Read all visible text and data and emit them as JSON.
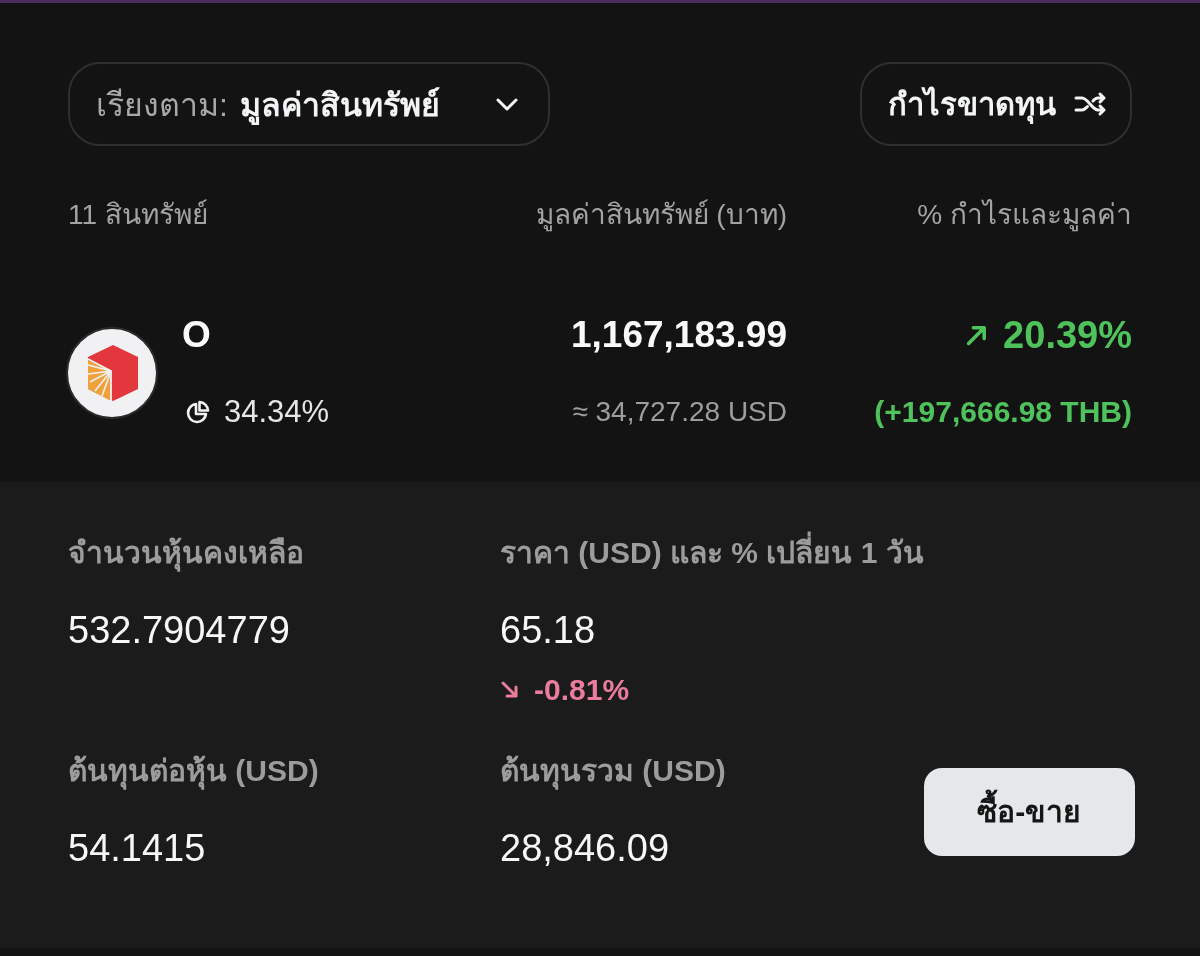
{
  "sort": {
    "label": "เรียงตาม:",
    "value": "มูลค่าสินทรัพย์"
  },
  "toggle_button": {
    "label": "กำไรขาดทุน"
  },
  "list_header": {
    "count": "11 สินทรัพย์",
    "column_2": "มูลค่าสินทรัพย์ (บาท)",
    "column_3": "% กำไรและมูลค่า"
  },
  "holding": {
    "symbol": "O",
    "portfolio_share": "34.34%",
    "value_thb": "1,167,183.99",
    "value_usd": "≈ 34,727.28 USD",
    "gain": true,
    "return_pct": "20.39%",
    "return_amount": "(+197,666.98 THB)"
  },
  "details": [
    {
      "label": "จำนวนหุ้นคงเหลือ",
      "value": "532.7904779"
    },
    {
      "label": "ราคา (USD) และ % เปลี่ยน 1 วัน",
      "value": "65.18",
      "gain": false,
      "change": "-0.81%"
    },
    {
      "label": "ต้นทุนต่อหุ้น (USD)",
      "value": "54.1415"
    },
    {
      "label": "ต้นทุนรวม (USD)",
      "value": "28,846.09"
    }
  ],
  "trade_button": {
    "label": "ซื้อ-ขาย"
  }
}
